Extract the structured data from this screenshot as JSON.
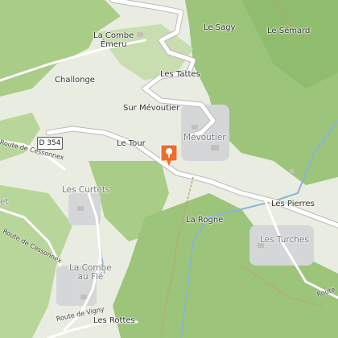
{
  "map": {
    "colors": {
      "land": "#e9ece0",
      "forest": "#9cc47a",
      "forest_light": "#b8d69a",
      "road": "#ffffff",
      "road_casing": "#b9b9b9",
      "water": "#8ab4dc",
      "settlement": "#d4d6d8",
      "marker": "#ef6c2b"
    },
    "road_shield": "D 354",
    "labels": {
      "la_combe_emeru": "La Combe\nÉmeru",
      "le_sagy": "Le Sagy",
      "le_semard": "Le Sémard",
      "challonge": "Challonge",
      "les_tattes": "Les Tattes",
      "sur_mevoutier": "Sur Mévoutier",
      "mevoutier": "Mévoutier",
      "le_tour": "Le Tour",
      "les_curtets": "Les Curtets",
      "les_pierres": "Les Pierres",
      "la_rogne": "La Rogne",
      "les_turches": "Les Turches",
      "la_combe_au_fle": "La Combe\nau Flé",
      "les_rottes": "Les Rottes",
      "et": "et"
    },
    "road_names": {
      "cessonnex_north": "Route de Cessonnex",
      "cessonnex_south": "Route de Cessonnex",
      "vigny": "Route de Vigny",
      "route_east": "Route"
    },
    "marker_icon": "location-pin-icon"
  }
}
